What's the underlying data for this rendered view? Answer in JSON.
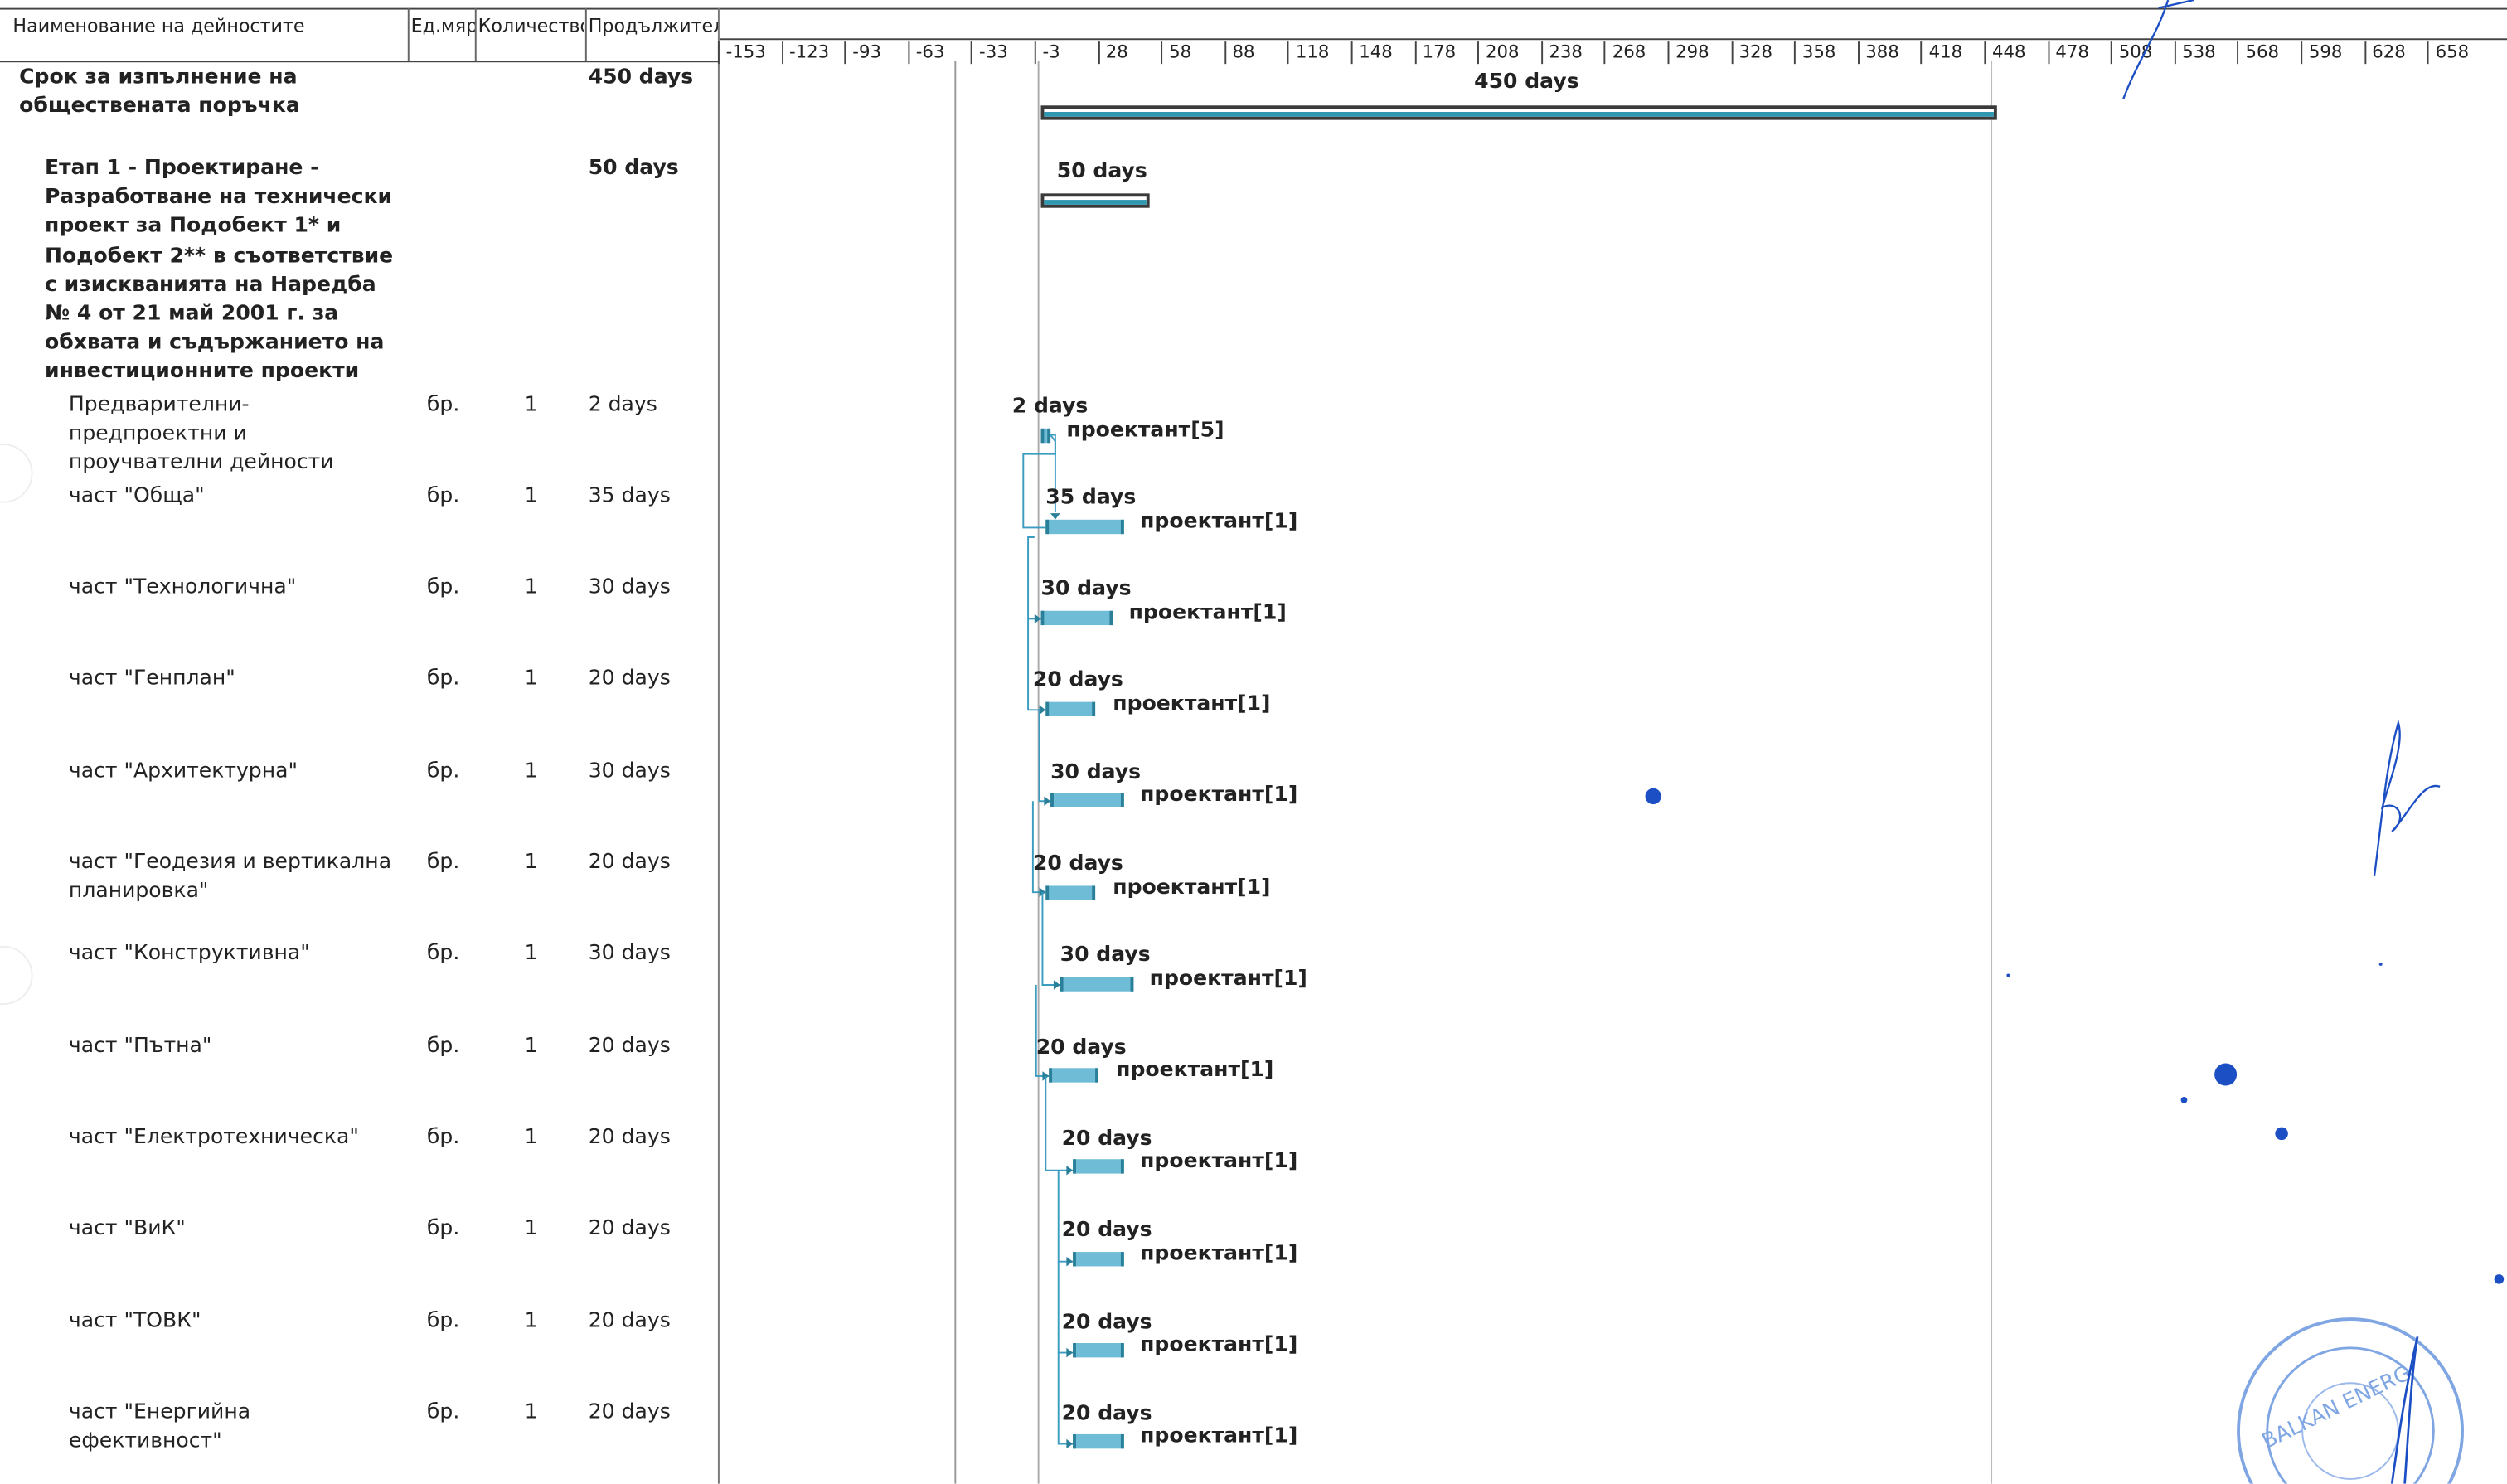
{
  "columns": {
    "name": "Наименование на дейностите",
    "unit": "Ед.мярка",
    "qty": "Количество",
    "duration": "Продължителност"
  },
  "timescale": [
    "-153",
    "-123",
    "-93",
    "-63",
    "-33",
    "-3",
    "28",
    "58",
    "88",
    "118",
    "148",
    "178",
    "208",
    "238",
    "268",
    "298",
    "328",
    "358",
    "388",
    "418",
    "448",
    "478",
    "508",
    "538",
    "568",
    "598",
    "628",
    "658"
  ],
  "rows": [
    {
      "name": "Срок за изпълнение на обществената поръчка",
      "unit": "",
      "qty": "",
      "duration": "450 days",
      "bar_label": "450 days",
      "resource": "",
      "kind": "summary"
    },
    {
      "name": "Етап 1 - Проектиране - Разработване на технически проект за Подобект 1* и Подобект 2** в съответствие с изискванията на Наредба № 4 от 21 май 2001 г. за обхвата и съдържанието на инвестиционните проекти",
      "unit": "",
      "qty": "",
      "duration": "50 days",
      "bar_label": "50 days",
      "resource": "",
      "kind": "summary"
    },
    {
      "name": "Предварителни- предпроектни и проучвателни дейности",
      "unit": "бр.",
      "qty": "1",
      "duration": "2 days",
      "bar_label": "2 days",
      "resource": "проектант[5]",
      "kind": "task"
    },
    {
      "name": "част \"Обща\"",
      "unit": "бр.",
      "qty": "1",
      "duration": "35 days",
      "bar_label": "35 days",
      "resource": "проектант[1]",
      "kind": "task"
    },
    {
      "name": "част \"Технологична\"",
      "unit": "бр.",
      "qty": "1",
      "duration": "30 days",
      "bar_label": "30 days",
      "resource": "проектант[1]",
      "kind": "task"
    },
    {
      "name": "част \"Генплан\"",
      "unit": "бр.",
      "qty": "1",
      "duration": "20 days",
      "bar_label": "20 days",
      "resource": "проектант[1]",
      "kind": "task"
    },
    {
      "name": "част \"Архитектурна\"",
      "unit": "бр.",
      "qty": "1",
      "duration": "30 days",
      "bar_label": "30 days",
      "resource": "проектант[1]",
      "kind": "task"
    },
    {
      "name": "част \"Геодезия и вертикална планировка\"",
      "unit": "бр.",
      "qty": "1",
      "duration": "20 days",
      "bar_label": "20 days",
      "resource": "проектант[1]",
      "kind": "task"
    },
    {
      "name": "част \"Конструктивна\"",
      "unit": "бр.",
      "qty": "1",
      "duration": "30 days",
      "bar_label": "30 days",
      "resource": "проектант[1]",
      "kind": "task"
    },
    {
      "name": "част \"Пътна\"",
      "unit": "бр.",
      "qty": "1",
      "duration": "20 days",
      "bar_label": "20 days",
      "resource": "проектант[1]",
      "kind": "task"
    },
    {
      "name": "част \"Електротехническа\"",
      "unit": "бр.",
      "qty": "1",
      "duration": "20 days",
      "bar_label": "20 days",
      "resource": "проектант[1]",
      "kind": "task"
    },
    {
      "name": "част \"ВиК\"",
      "unit": "бр.",
      "qty": "1",
      "duration": "20 days",
      "bar_label": "20 days",
      "resource": "проектант[1]",
      "kind": "task"
    },
    {
      "name": "част \"ТОВК\"",
      "unit": "бр.",
      "qty": "1",
      "duration": "20 days",
      "bar_label": "20 days",
      "resource": "проектант[1]",
      "kind": "task"
    },
    {
      "name": "част \"Енергийна ефективност\"",
      "unit": "бр.",
      "qty": "1",
      "duration": "20 days",
      "bar_label": "20 days",
      "resource": "проектант[1]",
      "kind": "task"
    }
  ],
  "stamp_text": "BALKAN ENERG",
  "colors": {
    "bar": "#6fbcd6",
    "bar_edge": "#2a7f99",
    "summary_fill": "#2f97b0",
    "ink": "#1d4fc4"
  }
}
